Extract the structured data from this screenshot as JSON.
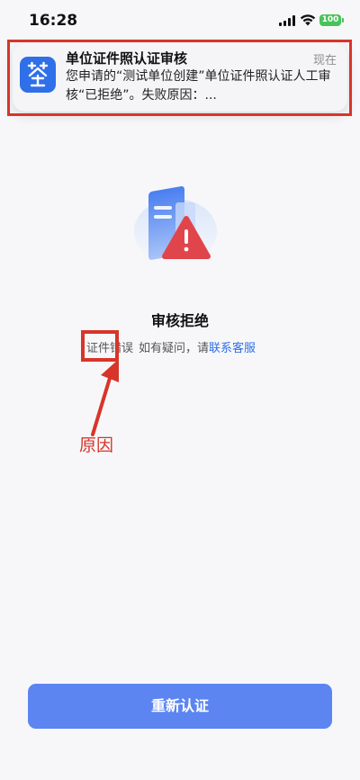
{
  "status_bar": {
    "time": "16:28",
    "battery_level": "100",
    "battery_color": "#49c25a"
  },
  "notification": {
    "app_icon": "app-logo-icon",
    "title": "单位证件照认证审核",
    "time": "现在",
    "body": "您申请的“测试单位创建”单位证件照认证人工审核“已拒绝”。失败原因：..."
  },
  "result": {
    "illustration": "warning-document-icon",
    "title": "审核拒绝",
    "reason": "证件错误",
    "hint": "如有疑问，请",
    "contact_link": "联系客服"
  },
  "annotation": {
    "label": "原因",
    "color": "#d8352a"
  },
  "action": {
    "button_label": "重新认证",
    "button_color": "#5c85f2"
  }
}
